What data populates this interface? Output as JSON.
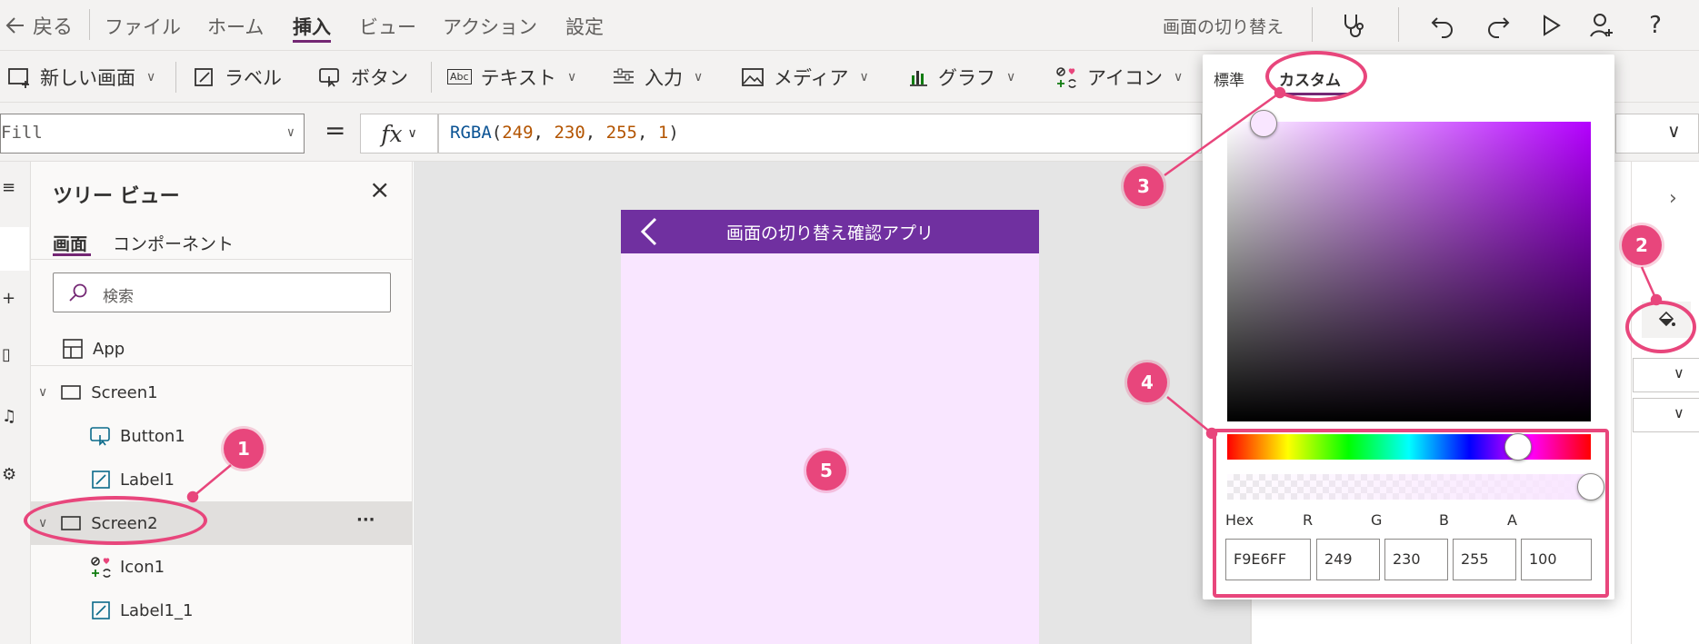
{
  "menubar": {
    "back_label": "戻る",
    "items": [
      "ファイル",
      "ホーム",
      "挿入",
      "ビュー",
      "アクション",
      "設定"
    ],
    "active_item": "挿入",
    "screen_transition_label": "画面の切り替え"
  },
  "ribbon": {
    "new_screen": "新しい画面",
    "label": "ラベル",
    "button": "ボタン",
    "text": "テキスト",
    "input": "入力",
    "media": "メディア",
    "chart": "グラフ",
    "icon": "アイコン"
  },
  "formula_bar": {
    "property": "Fill",
    "equals": "=",
    "fx": "fx",
    "formula_func": "RGBA",
    "formula_open": "(",
    "formula_r": "249",
    "formula_g": "230",
    "formula_b": "255",
    "formula_a": "1",
    "formula_comma": ", ",
    "formula_close": ")"
  },
  "tree": {
    "title": "ツリー ビュー",
    "tabs": [
      "画面",
      "コンポーネント"
    ],
    "active_tab": "画面",
    "search_placeholder": "検索",
    "items": {
      "app": "App",
      "screen1": "Screen1",
      "button1": "Button1",
      "label1": "Label1",
      "screen2": "Screen2",
      "icon1": "Icon1",
      "label1_1": "Label1_1"
    },
    "more": "···"
  },
  "canvas": {
    "screen_title": "画面の切り替え確認アプリ",
    "screen_fill": "#F9E6FF",
    "header_color": "#7030A0"
  },
  "color_picker": {
    "tabs": {
      "standard": "標準",
      "custom": "カスタム"
    },
    "active_tab": "カスタム",
    "channel_labels": {
      "hex": "Hex",
      "r": "R",
      "g": "G",
      "b": "B",
      "a": "A"
    },
    "values": {
      "hex": "F9E6FF",
      "r": "249",
      "g": "230",
      "b": "255",
      "a": "100"
    },
    "hue_position": 0.8,
    "alpha_position": 1.0
  },
  "annotations": [
    "1",
    "2",
    "3",
    "4",
    "5"
  ],
  "colors": {
    "accent": "#742774",
    "annotation": "#E8467C",
    "screen_fill": "#F9E6FF",
    "header": "#7030A0"
  }
}
